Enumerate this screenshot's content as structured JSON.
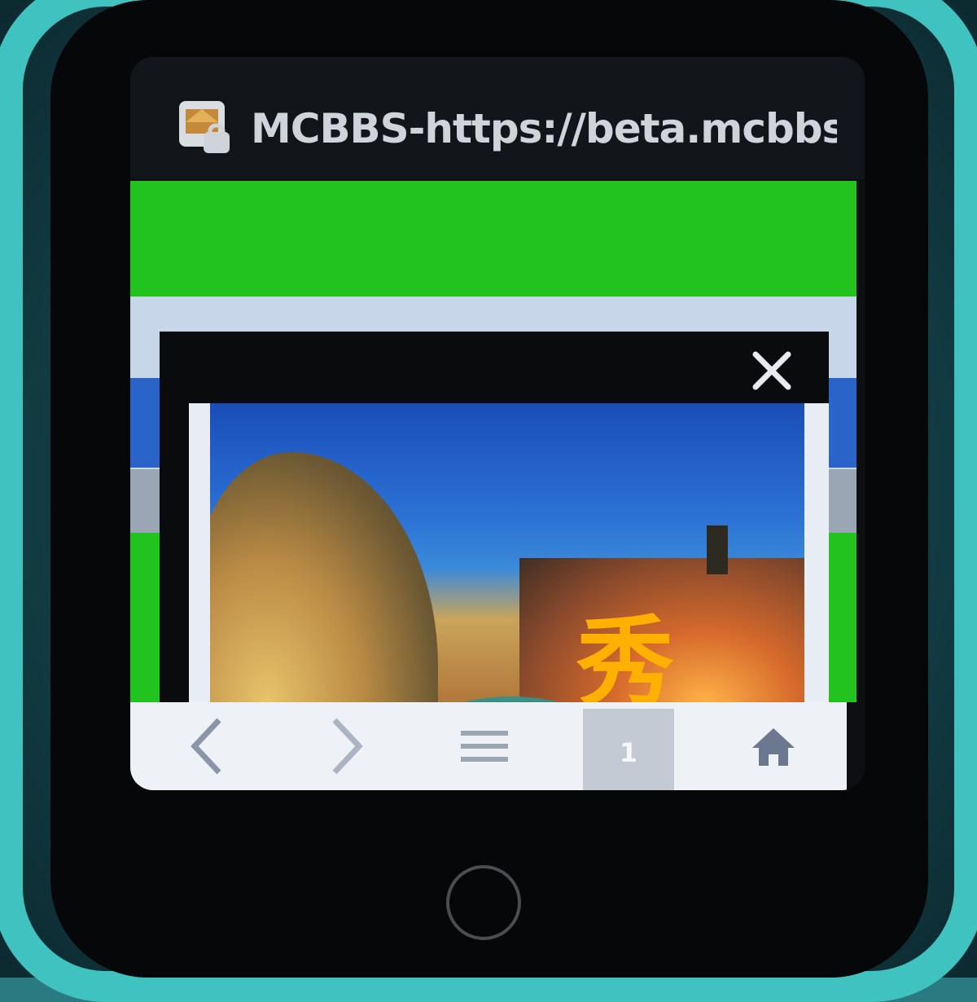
{
  "browser": {
    "title": "MCBBS-https://beta.mcbbs.net",
    "site_icon": "mcbbs-site-icon"
  },
  "popup": {
    "close_icon": "close-icon",
    "ad_chars": [
      "秀"
    ]
  },
  "page": {
    "bottom_text": ""
  },
  "navbar": {
    "back_icon": "chevron-left-icon",
    "forward_icon": "chevron-right-icon",
    "menu_icon": "menu-icon",
    "tab_count": "1",
    "home_icon": "home-icon"
  },
  "colors": {
    "accent_green": "#22c21f",
    "bumper": "#3fc2c0"
  }
}
